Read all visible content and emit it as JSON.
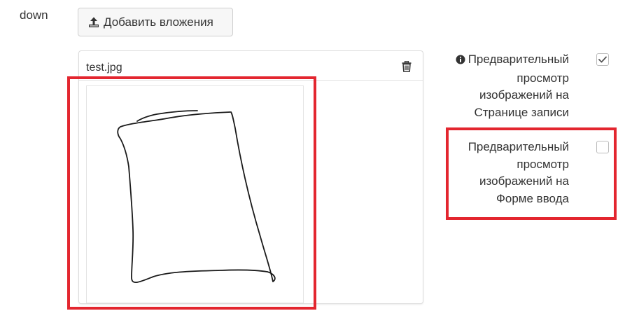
{
  "field": {
    "label": "down"
  },
  "toolbar": {
    "add_attachments_label": "Добавить вложения",
    "add_icon": "upload-icon"
  },
  "attachment": {
    "file_name": "test.jpg",
    "delete_icon": "trash-icon",
    "thumbnail_alt": "test.jpg"
  },
  "options": [
    {
      "label_lines": [
        "Предварительный",
        "просмотр",
        "изображений на",
        "Странице записи"
      ],
      "icon": "info-icon",
      "checked": true
    },
    {
      "label_lines": [
        "Предварительный",
        "просмотр",
        "изображений на",
        "Форме ввода"
      ],
      "checked": false
    }
  ],
  "colors": {
    "highlight": "#e3262f",
    "text": "#333333",
    "border": "#dcdcdc"
  }
}
